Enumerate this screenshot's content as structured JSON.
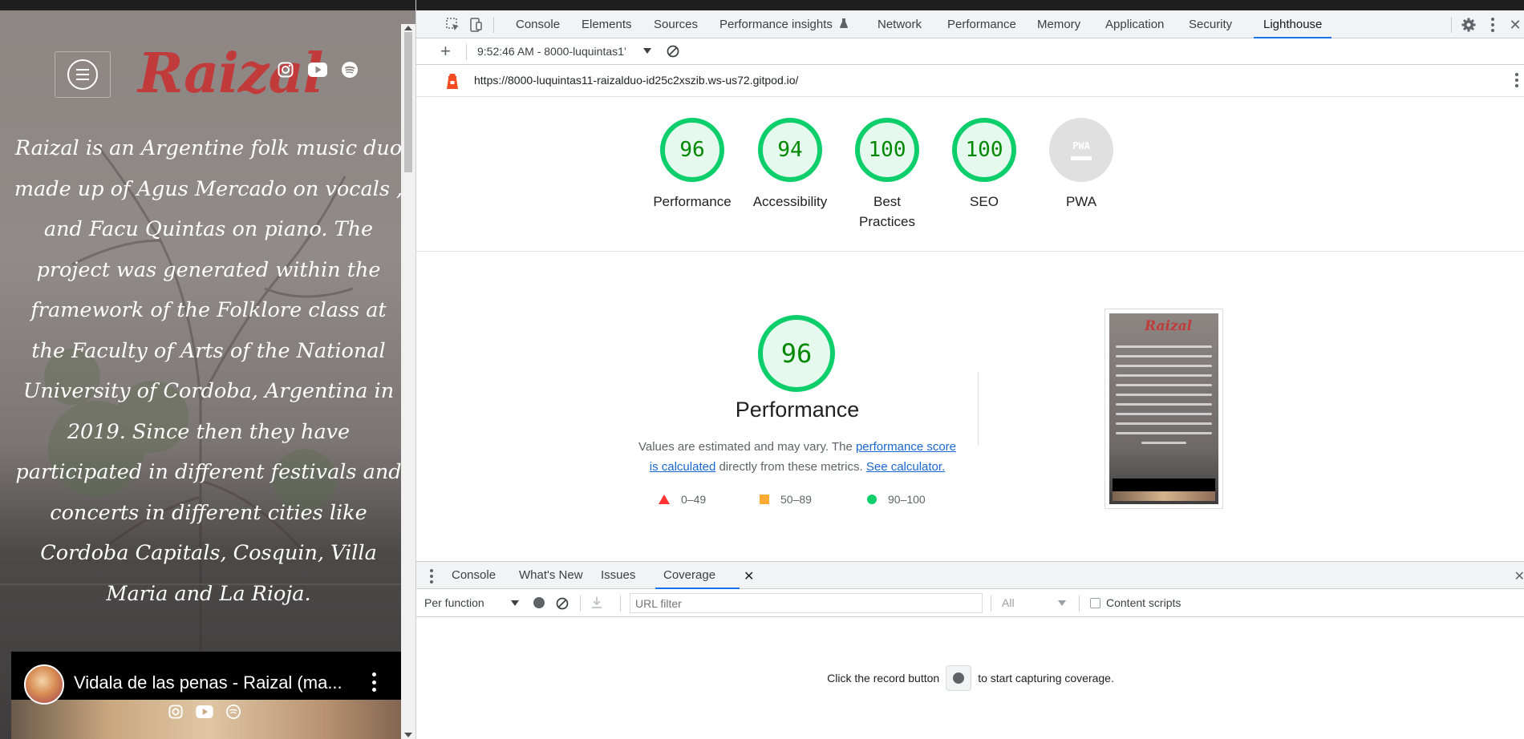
{
  "site": {
    "logo": "Raizal",
    "description": "Raizal is an Argentine folk music duo made up of Agus Mercado on vocals , and Facu Quintas on piano. The project was generated within the framework of the Folklore class at the Faculty of Arts of the National University of Cordoba, Argentina in 2019. Since then they have participated in different festivals and concerts in different cities like Cordoba Capitals, Cosquin, Villa Maria and La Rioja.",
    "video_title": "Vidala de las penas - Raizal (ma...",
    "social_icons": [
      "instagram-icon",
      "youtube-icon",
      "spotify-icon"
    ]
  },
  "devtools": {
    "tabs": [
      "Console",
      "Elements",
      "Sources",
      "Performance insights",
      "Network",
      "Performance",
      "Memory",
      "Application",
      "Security",
      "Lighthouse"
    ],
    "active_tab": "Lighthouse",
    "report_selector": "9:52:46 AM - 8000-luquintas1’",
    "url": "https://8000-luquintas11-raizalduo-id25c2xszib.ws-us72.gitpod.io/",
    "scores": [
      {
        "label": "Performance",
        "value": "96"
      },
      {
        "label": "Accessibility",
        "value": "94"
      },
      {
        "label": "Best Practices",
        "value": "100"
      },
      {
        "label": "SEO",
        "value": "100"
      },
      {
        "label": "PWA",
        "value": ""
      }
    ],
    "pwa_badge": "PWA",
    "performance": {
      "score": "96",
      "title": "Performance",
      "note_prefix": "Values are estimated and may vary. The ",
      "note_link": "performance score is calculated",
      "note_mid": " directly from these metrics. ",
      "note_link2": "See calculator.",
      "legend": [
        "0–49",
        "50–89",
        "90–100"
      ]
    },
    "drawer": {
      "tabs": [
        "Console",
        "What's New",
        "Issues",
        "Coverage"
      ],
      "active_tab": "Coverage",
      "mode": "Per function",
      "url_filter_placeholder": "URL filter",
      "type_filter": "All",
      "content_scripts": "Content scripts",
      "empty_prefix": "Click the record button",
      "empty_suffix": "to start capturing coverage."
    }
  },
  "colors": {
    "pass": "#0cce6b",
    "average": "#ffaa33",
    "fail": "#ff3333",
    "accent": "#1a73e8",
    "logo": "#c23b3b"
  }
}
